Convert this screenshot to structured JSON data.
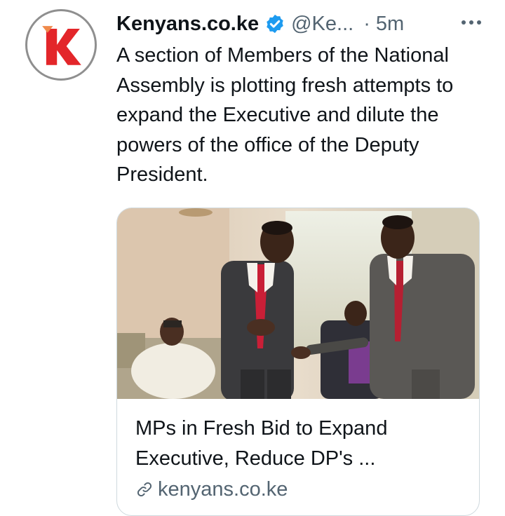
{
  "tweet": {
    "author_name": "Kenyans.co.ke",
    "author_handle": "@Ke...",
    "separator": "·",
    "time": "5m",
    "text": "A section of Members of the National Assembly is plotting fresh attempts to expand the Executive and dilute the powers of the office of the Deputy President."
  },
  "card": {
    "title": "MPs in Fresh Bid to Expand Executive, Reduce DP's ...",
    "domain": "kenyans.co.ke"
  },
  "icons": {
    "avatar": "kenyans-k-logo",
    "verified": "verified-badge-icon",
    "more": "more-options-icon",
    "link": "link-icon"
  },
  "colors": {
    "brand_red": "#e3262a",
    "verified_blue": "#1d9bf0",
    "secondary_text": "#536471",
    "card_border": "#cfd9de"
  }
}
